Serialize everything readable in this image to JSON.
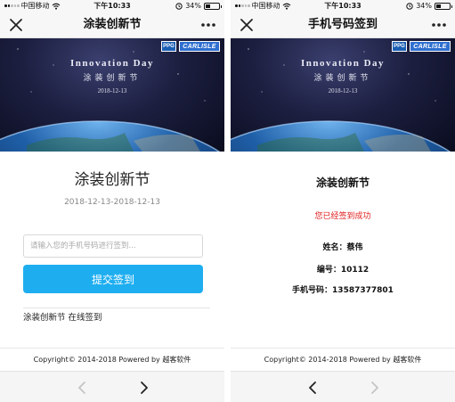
{
  "status_bar": {
    "carrier": "中国移动",
    "time": "下午10:33",
    "battery": "34%",
    "battery_level": 0.34
  },
  "left": {
    "nav_title": "涂装创新节",
    "banner": {
      "logo_ppg": "PPG",
      "logo_carlisle": "CARLISLE",
      "en_title": "Innovation Day",
      "cn_title": "涂装创新节",
      "date": "2018-12-13"
    },
    "event_title": "涂装创新节",
    "event_dates": "2018-12-13-2018-12-13",
    "phone_input": {
      "placeholder": "请输入您的手机号码进行签到...",
      "value": ""
    },
    "submit_label": "提交签到",
    "footer_text": "涂装创新节 在线签到",
    "copyright": "Copyright© 2014-2018 Powered by 越客软件",
    "back_enabled": false,
    "forward_enabled": true
  },
  "right": {
    "nav_title": "手机号码签到",
    "banner": {
      "logo_ppg": "PPG",
      "logo_carlisle": "CARLISLE",
      "en_title": "Innovation Day",
      "cn_title": "涂装创新节",
      "date": "2018-12-13"
    },
    "title": "涂装创新节",
    "success_message": "您已经签到成功",
    "name_line": "姓名：蔡伟",
    "id_line": "编号：10112",
    "phone_line": "手机号码：13587377801",
    "copyright": "Copyright© 2014-2018 Powered by 越客软件",
    "back_enabled": true,
    "forward_enabled": false
  },
  "icons": {
    "close": "close-icon",
    "more": "more-icon",
    "back": "chevron-left-icon",
    "forward": "chevron-right-icon",
    "wifi": "wifi-icon",
    "alarm": "alarm-icon",
    "battery": "battery-icon",
    "signal": "signal-icon"
  },
  "colors": {
    "accent": "#1eaef0",
    "success": "#e02020",
    "nav_bg": "#f7f7f7"
  }
}
